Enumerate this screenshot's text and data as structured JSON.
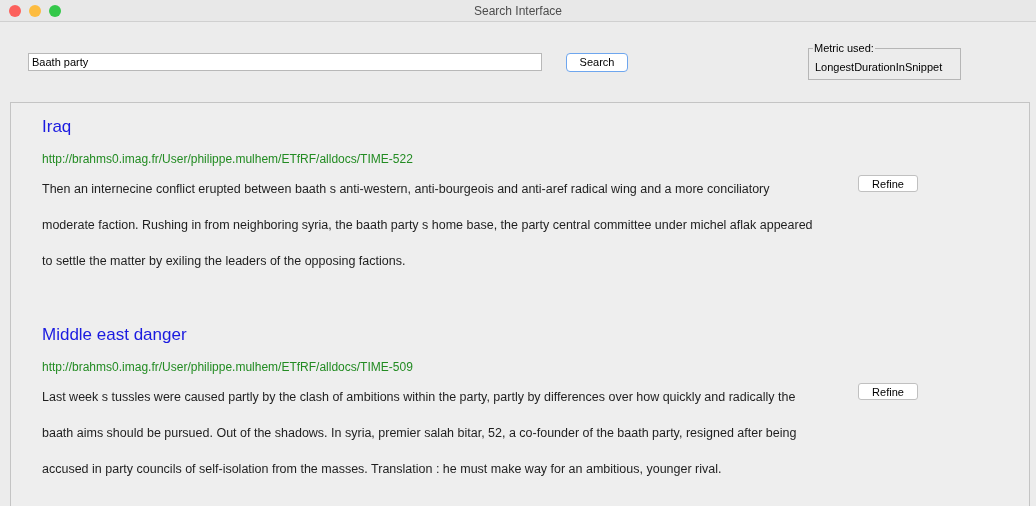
{
  "window": {
    "title": "Search Interface"
  },
  "search": {
    "value": "Baath party",
    "button": "Search"
  },
  "metric": {
    "legend": "Metric used:",
    "value": "LongestDurationInSnippet"
  },
  "results": [
    {
      "title": "Iraq",
      "url": "http://brahms0.imag.fr/User/philippe.mulhem/ETfRF/alldocs/TIME-522",
      "snippet_lines": [
        "Then an internecine conflict erupted between baath s anti-western, anti-bourgeois and anti-aref radical wing and a more conciliatory",
        "moderate faction. Rushing in from neighboring syria, the baath party s home base, the party central committee under michel aflak appeared",
        "to settle the matter by exiling the leaders of the opposing factions."
      ],
      "button": "Refine"
    },
    {
      "title": "Middle east danger",
      "url": "http://brahms0.imag.fr/User/philippe.mulhem/ETfRF/alldocs/TIME-509",
      "snippet_lines": [
        "Last week s tussles were caused partly by the clash of ambitions within the party, partly by differences over how quickly and radically the",
        "baath aims should be pursued. Out of the shadows. In syria, premier salah bitar, 52, a co-founder of the baath party, resigned after being",
        "accused in party councils of self-isolation from the masses. Translation : he must make way for an ambitious, younger rival."
      ],
      "button": "Refine"
    }
  ]
}
